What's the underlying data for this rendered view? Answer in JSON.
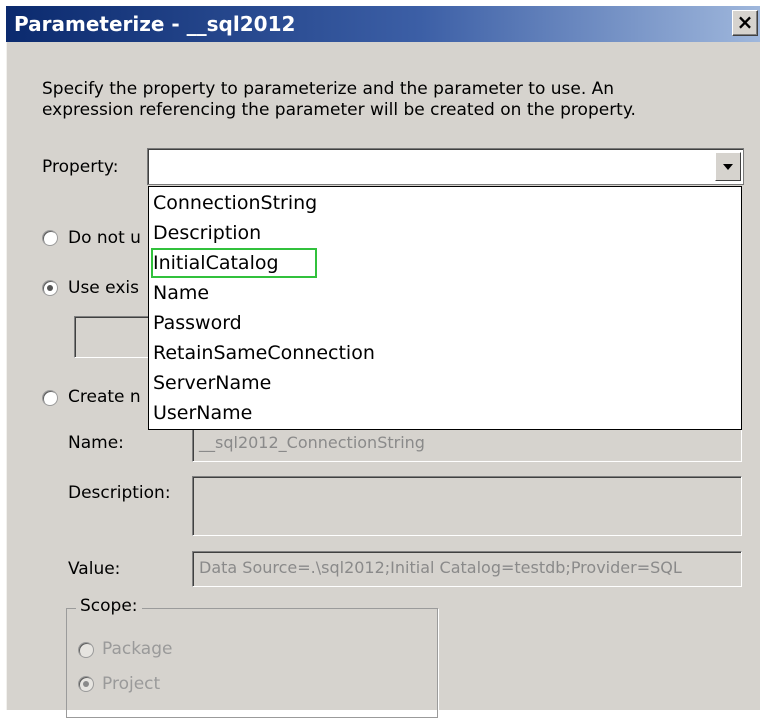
{
  "window": {
    "title": "Parameterize - __sql2012",
    "close_glyph": "×"
  },
  "instructions": "Specify the property to parameterize and the parameter to use. An\nexpression referencing the parameter will be created on the property.",
  "property": {
    "label": "Property:",
    "value": "",
    "options": [
      "ConnectionString",
      "Description",
      "InitialCatalog",
      "Name",
      "Password",
      "RetainSameConnection",
      "ServerName",
      "UserName"
    ],
    "highlighted": "InitialCatalog",
    "highlight_color": "#31c13c"
  },
  "radio_options": {
    "do_not_use": {
      "label": "Do not u",
      "selected": false
    },
    "use_existing": {
      "label": "Use exis",
      "selected": true
    },
    "create_new": {
      "label": "Create n",
      "selected": false
    }
  },
  "form": {
    "name_label": "Name:",
    "name_value": "__sql2012_ConnectionString",
    "description_label": "Description:",
    "description_value": "",
    "value_label": "Value:",
    "value_value": "Data Source=.\\sql2012;Initial Catalog=testdb;Provider=SQL"
  },
  "scope": {
    "legend": "Scope:",
    "package_label": "Package",
    "project_label": "Project",
    "selected": "Project"
  },
  "colors": {
    "titlebar_start": "#0b2a6e",
    "titlebar_end": "#9fb7dc",
    "dialog_bg": "#d6d3ce"
  }
}
